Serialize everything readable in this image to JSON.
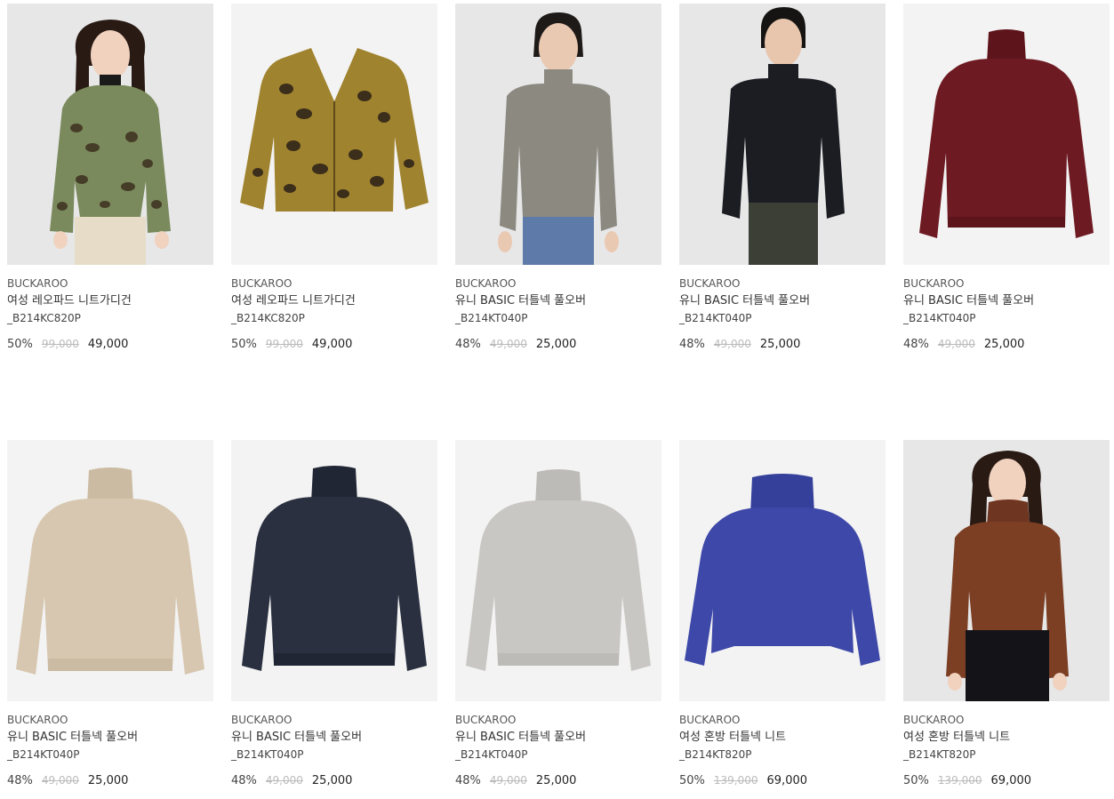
{
  "products": [
    {
      "brand": "BUCKAROO",
      "name": "여성 레오파드 니트가디건",
      "code": "_B214KC820P",
      "discount": "50%",
      "original_price": "99,000",
      "sale_price": "49,000",
      "image": "model-leopard-cardigan-green",
      "color": "#7a8a5c"
    },
    {
      "brand": "BUCKAROO",
      "name": "여성 레오파드 니트가디건",
      "code": "_B214KC820P",
      "discount": "50%",
      "original_price": "99,000",
      "sale_price": "49,000",
      "image": "leopard-cardigan-mustard",
      "color": "#a0832e"
    },
    {
      "brand": "BUCKAROO",
      "name": "유니 BASIC 터틀넥 풀오버",
      "code": "_B214KT040P",
      "discount": "48%",
      "original_price": "49,000",
      "sale_price": "25,000",
      "image": "model-turtleneck-taupe",
      "color": "#8c8a80"
    },
    {
      "brand": "BUCKAROO",
      "name": "유니 BASIC 터틀넥 풀오버",
      "code": "_B214KT040P",
      "discount": "48%",
      "original_price": "49,000",
      "sale_price": "25,000",
      "image": "model-turtleneck-black",
      "color": "#1b1d22"
    },
    {
      "brand": "BUCKAROO",
      "name": "유니 BASIC 터틀넥 풀오버",
      "code": "_B214KT040P",
      "discount": "48%",
      "original_price": "49,000",
      "sale_price": "25,000",
      "image": "turtleneck-burgundy",
      "color": "#6e1a22"
    },
    {
      "brand": "BUCKAROO",
      "name": "유니 BASIC 터틀넥 풀오버",
      "code": "_B214KT040P",
      "discount": "48%",
      "original_price": "49,000",
      "sale_price": "25,000",
      "image": "turtleneck-beige",
      "color": "#d7c7b0"
    },
    {
      "brand": "BUCKAROO",
      "name": "유니 BASIC 터틀넥 풀오버",
      "code": "_B214KT040P",
      "discount": "48%",
      "original_price": "49,000",
      "sale_price": "25,000",
      "image": "turtleneck-navy",
      "color": "#2a3040"
    },
    {
      "brand": "BUCKAROO",
      "name": "유니 BASIC 터틀넥 풀오버",
      "code": "_B214KT040P",
      "discount": "48%",
      "original_price": "49,000",
      "sale_price": "25,000",
      "image": "turtleneck-light-gray",
      "color": "#c9c7c3"
    },
    {
      "brand": "BUCKAROO",
      "name": "여성 혼방 터틀넥 니트",
      "code": "_B214KT820P",
      "discount": "50%",
      "original_price": "139,000",
      "sale_price": "69,000",
      "image": "turtleneck-blue-melange",
      "color": "#3e48a8"
    },
    {
      "brand": "BUCKAROO",
      "name": "여성 혼방 터틀넥 니트",
      "code": "_B214KT820P",
      "discount": "50%",
      "original_price": "139,000",
      "sale_price": "69,000",
      "image": "model-turtleneck-brown",
      "color": "#7c3f24"
    }
  ]
}
